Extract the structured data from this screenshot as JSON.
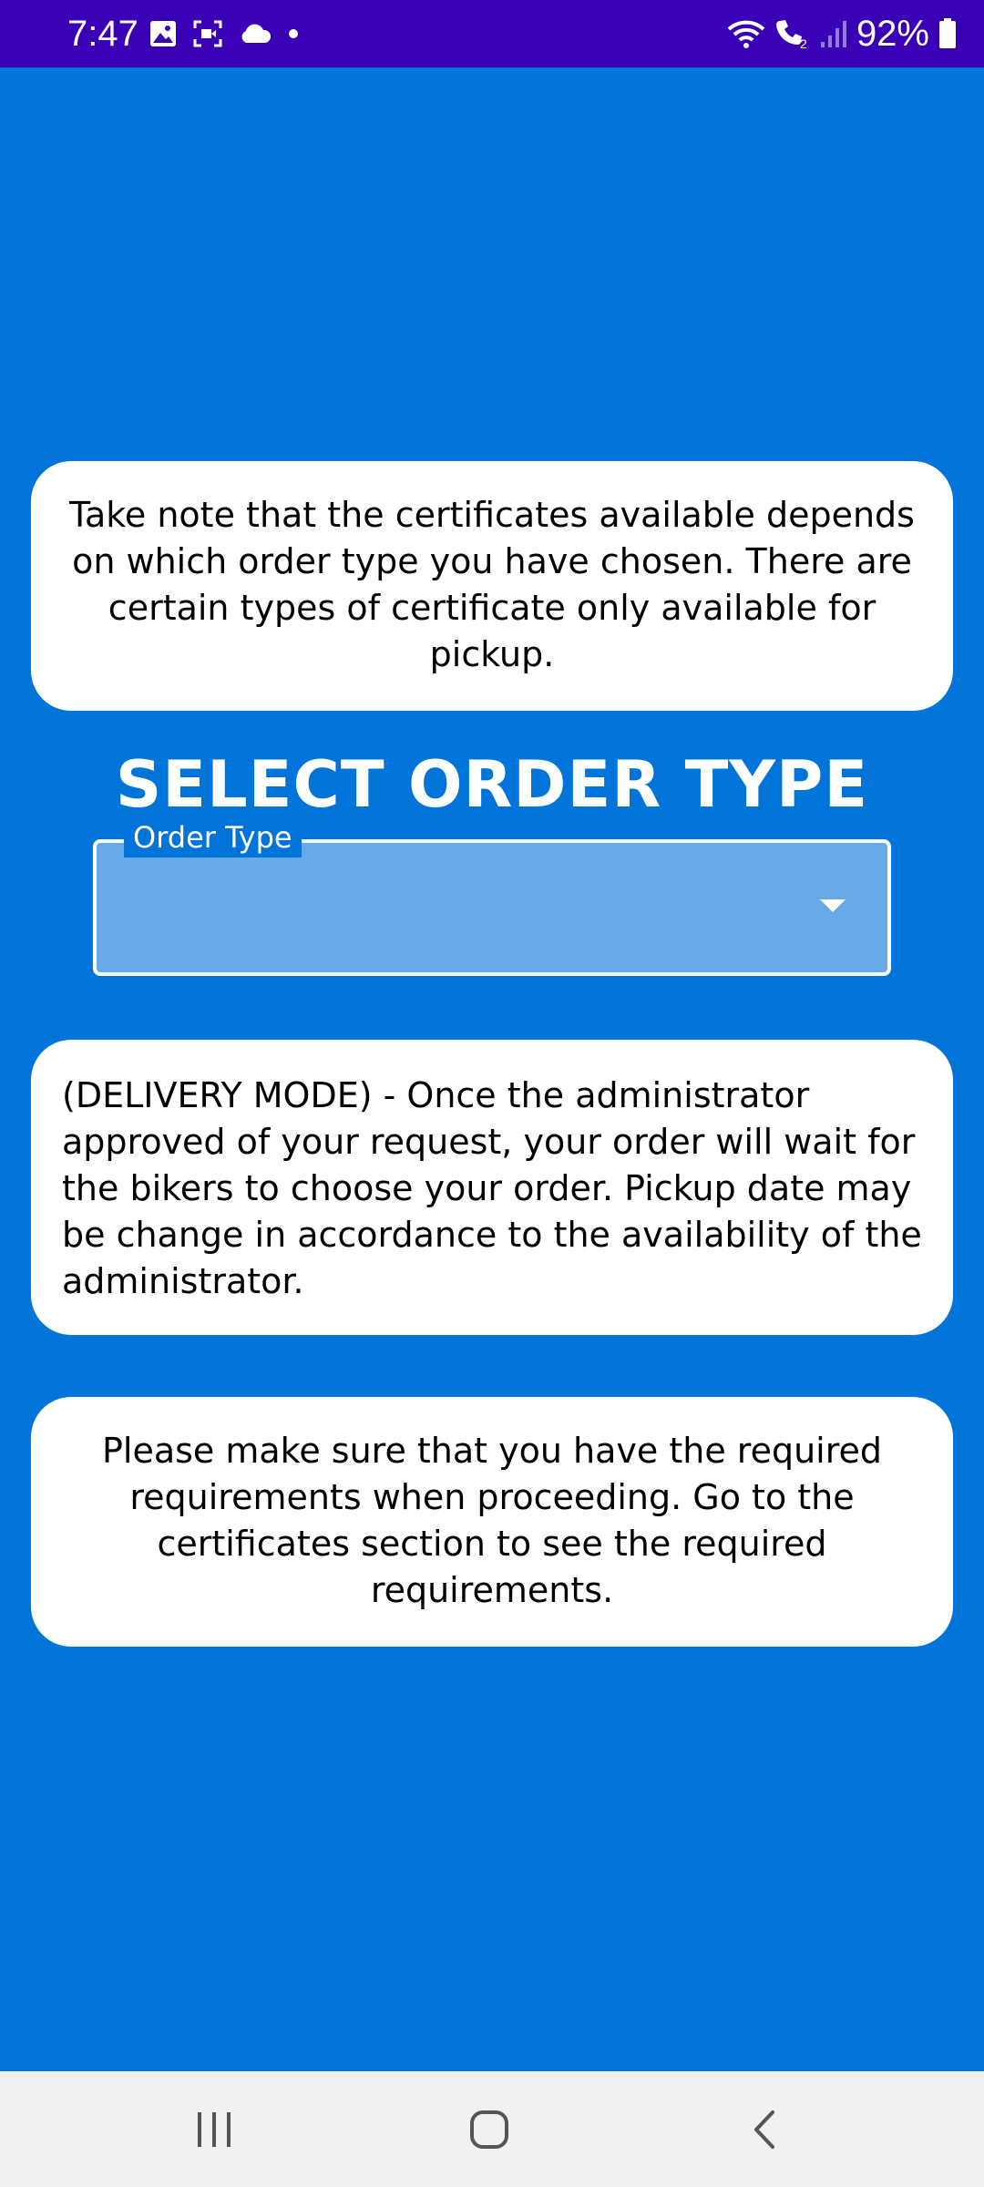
{
  "status_bar": {
    "time": "7:47",
    "battery": "92%",
    "icons_left": [
      "gallery-icon",
      "screen-record-icon",
      "cloud-icon",
      "notification-dot-icon"
    ],
    "icons_right": [
      "wifi-icon",
      "wifi-calling-icon",
      "signal-icon",
      "battery-icon"
    ]
  },
  "note_card": {
    "text": "Take note that the certificates available depends on which order type you have chosen. There are certain types of certificate only available for pickup."
  },
  "title": "SELECT ORDER TYPE",
  "order_type_field": {
    "label": "Order Type",
    "value": ""
  },
  "delivery_card": {
    "text": "(DELIVERY MODE) - Once the administrator approved of your request, your order will wait for the bikers to choose your order. Pickup date may be change in accordance to the availability of the administrator."
  },
  "requirements_card": {
    "text": "Please make sure that you have the required requirements when proceeding. Go to the certificates section to see the required requirements."
  },
  "nav_bar": {
    "buttons": [
      "recents-icon",
      "home-icon",
      "back-icon"
    ]
  },
  "colors": {
    "background": "#0074d9",
    "status_bar": "#3a00b5",
    "card": "#ffffff",
    "dropdown_fill": "#68a9e8",
    "nav_bar": "#f1f1f1"
  }
}
